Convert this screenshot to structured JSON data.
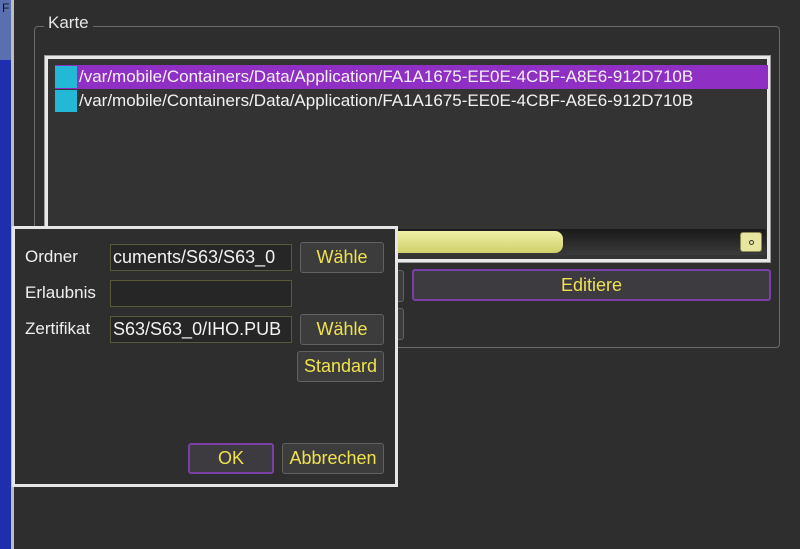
{
  "edge": {
    "glyph": "F"
  },
  "group": {
    "title": "Karte"
  },
  "list": {
    "items": [
      {
        "path": "/var/mobile/Containers/Data/Application/FA1A1675-EE0E-4CBF-A8E6-912D710B",
        "selected": true
      },
      {
        "path": "/var/mobile/Containers/Data/Application/FA1A1675-EE0E-4CBF-A8E6-912D710B",
        "selected": false
      }
    ]
  },
  "buttons": {
    "edit": "Editiere"
  },
  "dialog": {
    "folder_label": "Ordner",
    "folder_value": "cuments/S63/S63_0",
    "folder_choose": "Wähle",
    "permit_label": "Erlaubnis",
    "permit_value": "",
    "certificate_label": "Zertifikat",
    "certificate_value": "S63/S63_0/IHO.PUB",
    "certificate_choose": "Wähle",
    "default_button": "Standard",
    "ok_button": "OK",
    "cancel_button": "Abbrechen"
  },
  "colors": {
    "accent_text": "#f0e24e",
    "selection": "#8f2fc4",
    "row_icon": "#22b8d6",
    "scroll_thumb": "#e0e08a"
  }
}
